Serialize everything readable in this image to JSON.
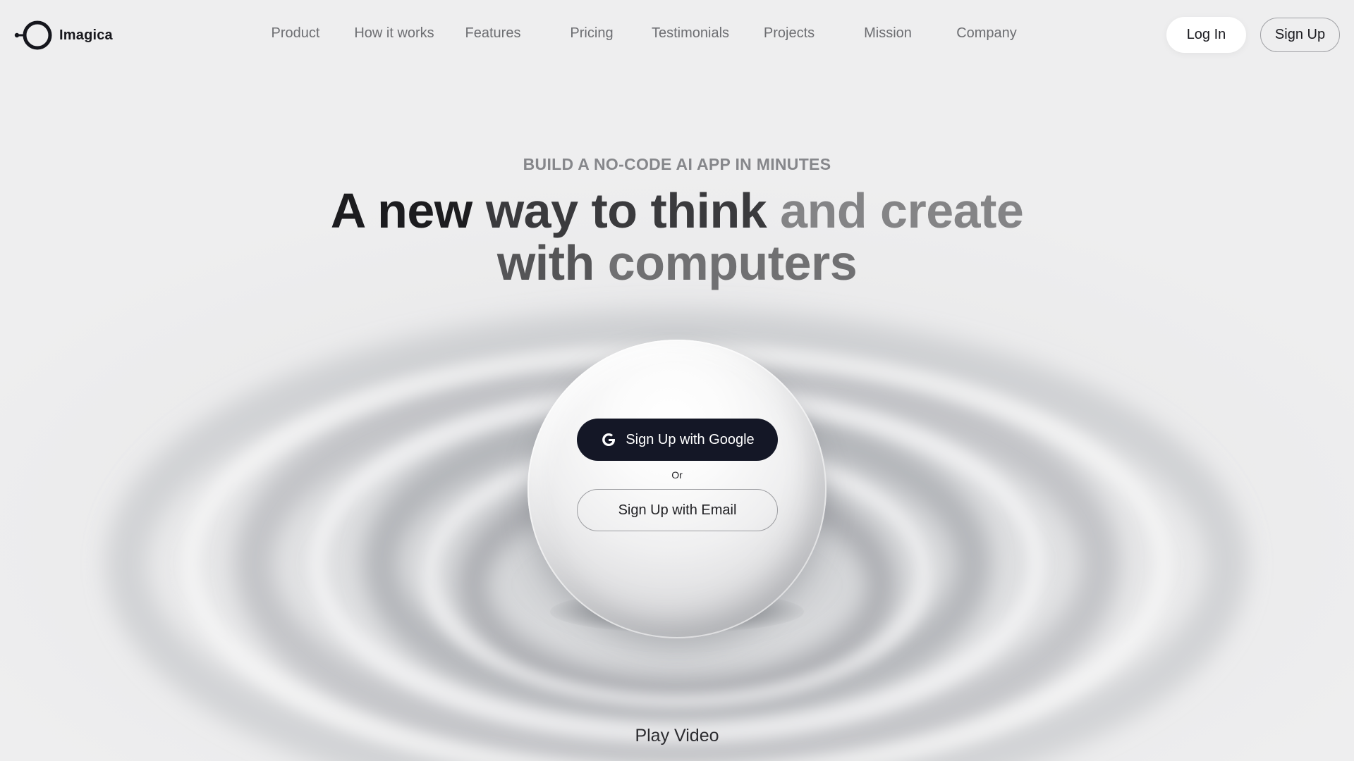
{
  "brand": {
    "name": "Imagica",
    "logo_icon": "ring-logo-icon"
  },
  "nav": {
    "items": [
      {
        "label": "Product"
      },
      {
        "label": "How it works"
      },
      {
        "label": "Features"
      },
      {
        "label": "Pricing"
      },
      {
        "label": "Testimonials"
      },
      {
        "label": "Projects"
      },
      {
        "label": "Mission"
      },
      {
        "label": "Company"
      }
    ]
  },
  "auth": {
    "login_label": "Log In",
    "signup_label": "Sign Up"
  },
  "hero": {
    "eyebrow": "BUILD A NO-CODE AI APP IN MINUTES",
    "headline_parts": [
      "A new",
      "way to",
      "think",
      "and create",
      "with",
      "computers"
    ]
  },
  "cta": {
    "google_label": "Sign Up with Google",
    "google_icon": "google-g-icon",
    "or_label": "Or",
    "email_label": "Sign Up with Email"
  },
  "video": {
    "label": "Play Video"
  },
  "colors": {
    "background": "#eeeeef",
    "google_button": "#141726",
    "headline_dark": "#1c1c1f",
    "headline_light": "#848486",
    "nav_text": "#6d6e72"
  }
}
